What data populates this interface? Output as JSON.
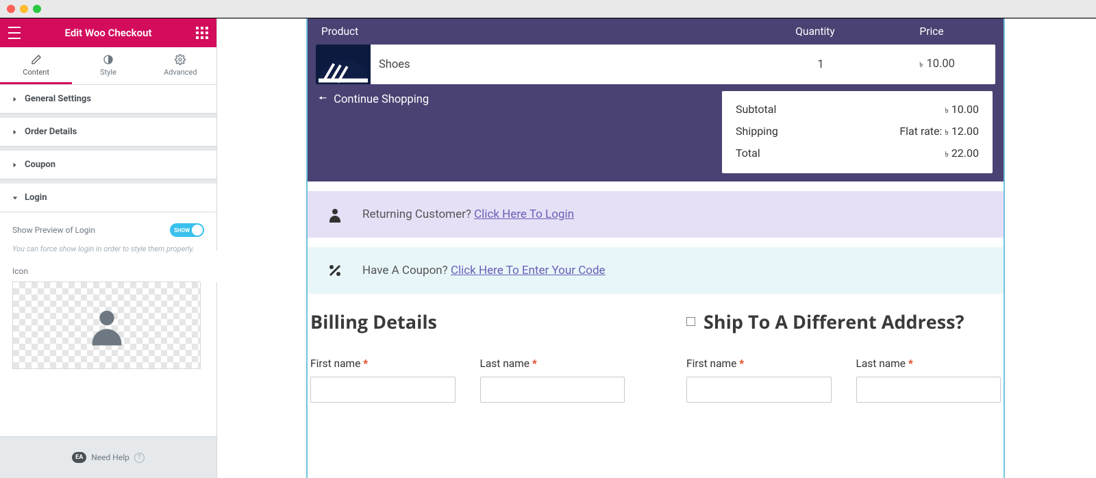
{
  "sidebar": {
    "title": "Edit Woo Checkout",
    "tabs": {
      "content": "Content",
      "style": "Style",
      "advanced": "Advanced"
    },
    "sections": {
      "general": "General Settings",
      "order_details": "Order Details",
      "coupon": "Coupon",
      "login": "Login"
    },
    "login_panel": {
      "toggle_label": "Show Preview of Login",
      "toggle_state_label": "SHOW",
      "help_text": "You can force show login in order to style them properly.",
      "icon_label": "Icon"
    },
    "footer": {
      "need_help": "Need Help",
      "badge": "EA"
    }
  },
  "preview": {
    "order": {
      "headers": {
        "product": "Product",
        "quantity": "Quantity",
        "price": "Price"
      },
      "items": [
        {
          "name": "Shoes",
          "qty": "1",
          "price": "10.00",
          "currency": "৳"
        }
      ],
      "continue": "Continue Shopping",
      "totals": {
        "subtotal_label": "Subtotal",
        "subtotal_value": "10.00",
        "shipping_label": "Shipping",
        "shipping_prefix": "Flat rate:",
        "shipping_value": "12.00",
        "total_label": "Total",
        "total_value": "22.00",
        "currency": "৳"
      }
    },
    "login_banner": {
      "text": "Returning Customer?",
      "link": "Click Here To Login"
    },
    "coupon_banner": {
      "text": "Have A Coupon?",
      "link": "Click Here To Enter Your Code"
    },
    "billing": {
      "title": "Billing Details",
      "first_name": "First name",
      "last_name": "Last name"
    },
    "shipping": {
      "title": "Ship To A Different Address?",
      "first_name": "First name",
      "last_name": "Last name"
    },
    "required_mark": "*"
  }
}
